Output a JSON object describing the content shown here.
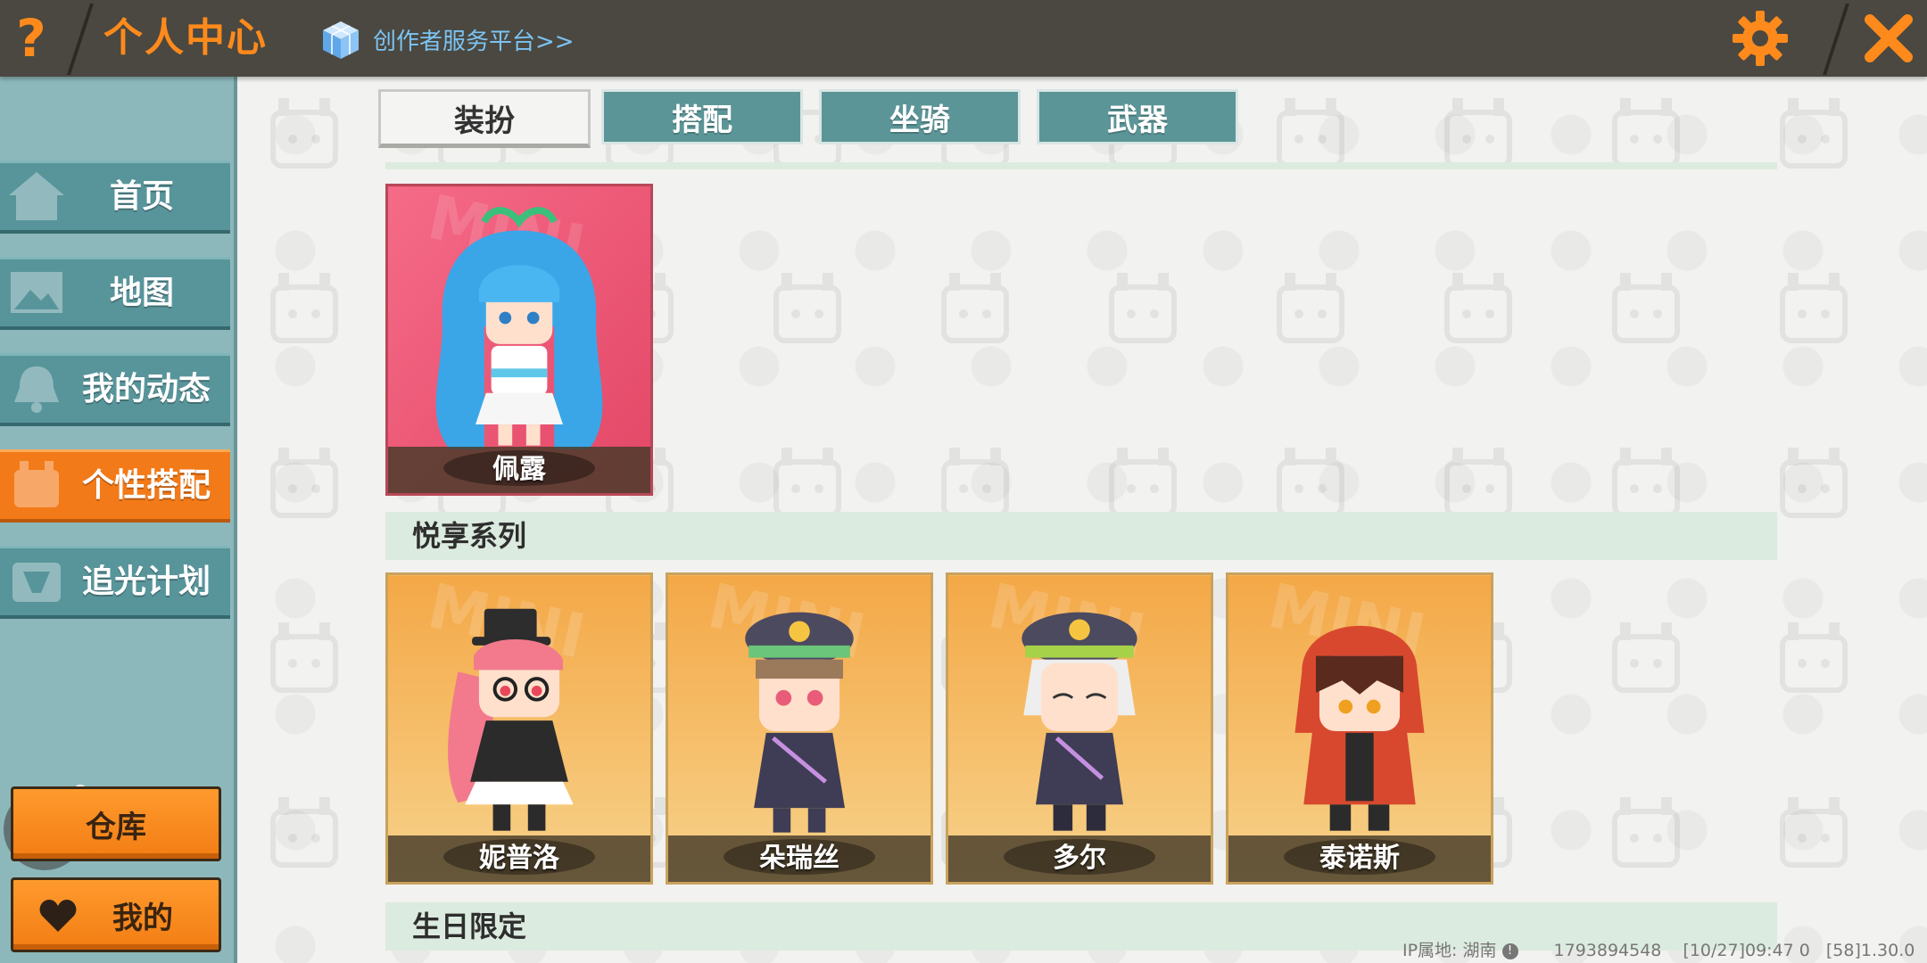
{
  "header": {
    "help_glyph": "?",
    "title": "个人中心",
    "creator_link": "创作者服务平台>>",
    "settings_icon": "gear-icon",
    "close_icon": "close-icon",
    "accent_color": "#ff8a1c"
  },
  "sidebar": {
    "items": [
      {
        "label": "首页",
        "icon": "house-icon"
      },
      {
        "label": "地图",
        "icon": "map-icon"
      },
      {
        "label": "我的动态",
        "icon": "bell-icon"
      },
      {
        "label": "个性搭配",
        "icon": "outfit-icon",
        "active": true
      },
      {
        "label": "追光计划",
        "icon": "spotlight-icon"
      }
    ],
    "warehouse_button": "仓库",
    "mine_button": "我的"
  },
  "tabs": [
    {
      "label": "装扮",
      "active": true
    },
    {
      "label": "搭配"
    },
    {
      "label": "坐骑"
    },
    {
      "label": "武器"
    }
  ],
  "sections": {
    "featured": [
      {
        "name": "佩露"
      }
    ],
    "yuexiang": {
      "title": "悦享系列",
      "cards": [
        {
          "name": "妮普洛"
        },
        {
          "name": "朵瑞丝"
        },
        {
          "name": "多尔"
        },
        {
          "name": "泰诺斯"
        }
      ]
    },
    "birthday": {
      "title": "生日限定"
    }
  },
  "footer": {
    "ip": "IP属地: 湖南",
    "uid": "1793894548",
    "time": "[10/27]09:47",
    "zero": "0",
    "version": "[58]1.30.0"
  }
}
